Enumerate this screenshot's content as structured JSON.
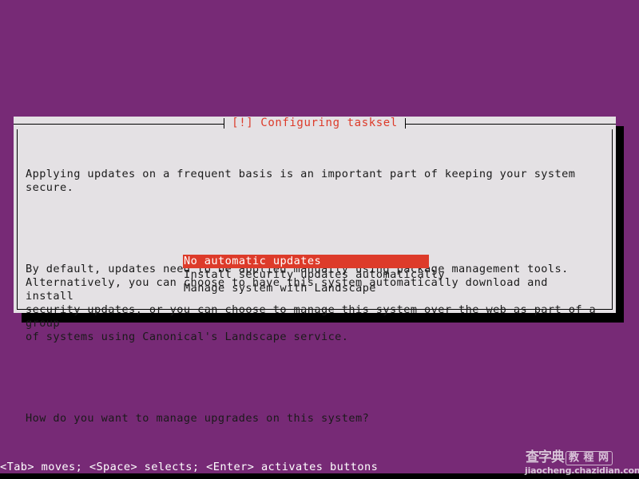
{
  "colors": {
    "background_purple": "#772a76",
    "dialog_background": "#e4e1e4",
    "accent_red": "#dd3b2a",
    "text": "#1a1a1a",
    "shadow": "#000000",
    "selected_text": "#ffffff"
  },
  "dialog": {
    "title": "[!] Configuring tasksel",
    "paragraphs": [
      "Applying updates on a frequent basis is an important part of keeping your system secure.",
      "By default, updates need to be applied manually using package management tools.\nAlternatively, you can choose to have this system automatically download and install\nsecurity updates, or you can choose to manage this system over the web as part of a group\nof systems using Canonical's Landscape service.",
      "How do you want to manage upgrades on this system?"
    ],
    "menu": {
      "selected_index": 0,
      "options": [
        "No automatic updates",
        "Install security updates automatically",
        "Manage system with Landscape"
      ]
    }
  },
  "status_bar": {
    "hint": "<Tab> moves; <Space> selects; <Enter> activates buttons"
  },
  "watermark": {
    "brand_main": "查字典",
    "brand_box": "教 程 网",
    "url": "jiaocheng.chazidian.com"
  }
}
